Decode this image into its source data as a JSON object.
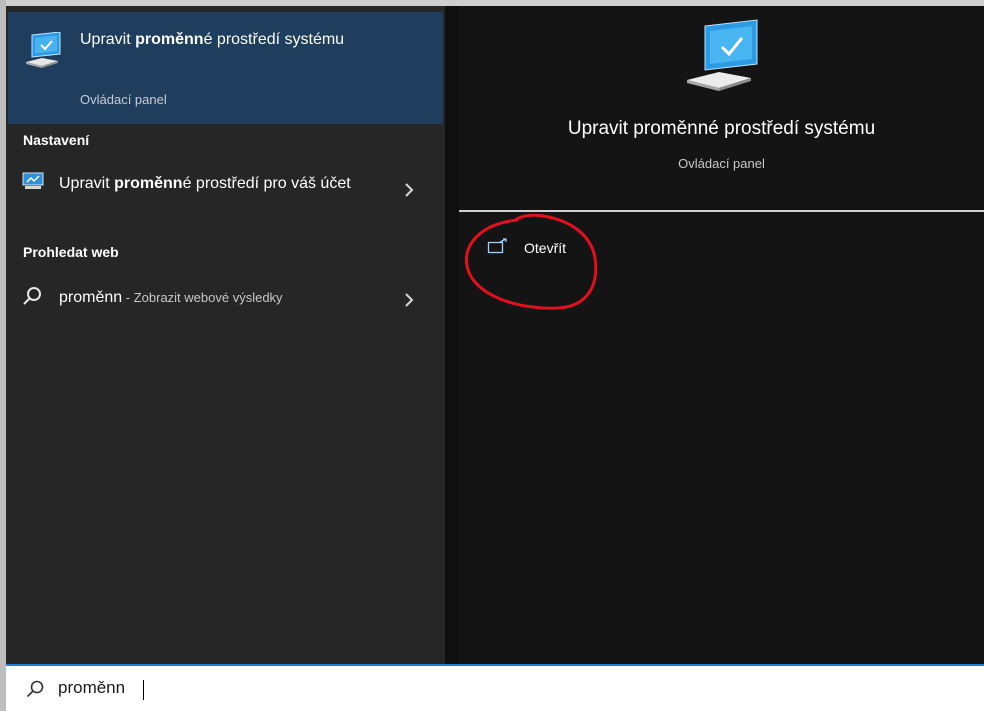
{
  "best_match": {
    "title_pre": "Upravit ",
    "title_bold": "proměnn",
    "title_post": "é prostředí systému",
    "subtitle": "Ovládací panel",
    "icon": "computer-monitor-icon"
  },
  "settings": {
    "heading": "Nastavení",
    "items": [
      {
        "title_pre": "Upravit ",
        "title_bold": "proměnn",
        "title_post": "é prostředí pro váš účet",
        "icon": "monitor-settings-icon"
      }
    ]
  },
  "web": {
    "heading": "Prohledat web",
    "items": [
      {
        "query": "proměnn",
        "suffix": " - Zobrazit webové výsledky",
        "icon": "search-icon"
      }
    ]
  },
  "detail": {
    "title": "Upravit proměnné prostředí systému",
    "subtitle": "Ovládací panel",
    "icon": "computer-monitor-icon",
    "actions": [
      {
        "label": "Otevřít",
        "icon": "open-external-icon"
      }
    ]
  },
  "search": {
    "value": "proměnn",
    "icon": "search-icon"
  },
  "colors": {
    "accent": "#1e7fd8",
    "selected_bg": "#1f3d5c",
    "annotation": "#e01020"
  }
}
